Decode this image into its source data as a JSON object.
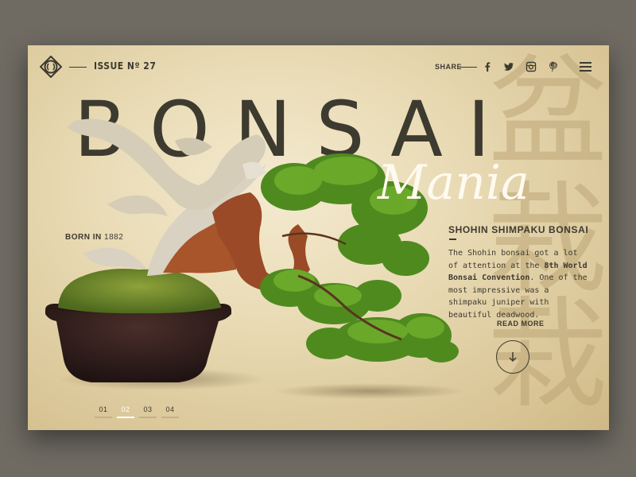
{
  "header": {
    "issue": "ISSUE Nº 27",
    "share_label": "SHARE",
    "social": [
      "facebook-icon",
      "twitter-icon",
      "instagram-icon",
      "pinterest-icon"
    ]
  },
  "hero": {
    "title": "BONSAI",
    "script": "Mania",
    "born_prefix": "BORN IN",
    "born_year": "1882"
  },
  "info": {
    "title": "SHOHIN SHIMPAKU BONSAI",
    "body_1": "The Shohin bonsai got a lot of attention at the ",
    "body_bold": "8th World Bonsai Convention",
    "body_2": ". One of the most impressive was a shimpaku juniper with beautiful deadwood.",
    "read_more": "READ MORE"
  },
  "pager": {
    "items": [
      "01",
      "02",
      "03",
      "04"
    ],
    "active": 1
  },
  "kanji": [
    "盆",
    "栽"
  ],
  "colors": {
    "text": "#3d3a30",
    "accent": "#fffaf0",
    "background": "#e9dbb5"
  }
}
